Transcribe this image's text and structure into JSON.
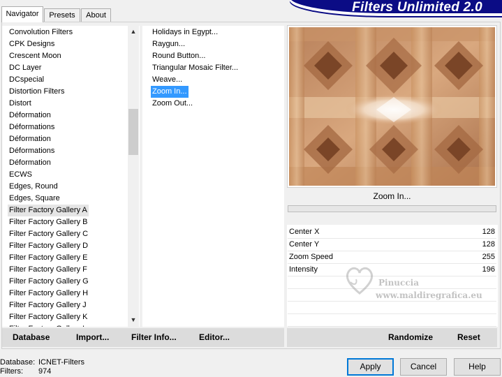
{
  "tabs": [
    {
      "label": "Navigator",
      "active": true
    },
    {
      "label": "Presets",
      "active": false
    },
    {
      "label": "About",
      "active": false
    }
  ],
  "banner": {
    "title": "Filters Unlimited 2.0"
  },
  "categories": {
    "items": [
      "Convolution Filters",
      "CPK Designs",
      "Crescent Moon",
      "DC Layer",
      "DCspecial",
      "Distortion Filters",
      "Distort",
      "Déformation",
      "Déformations",
      "Déformation",
      "Déformations",
      "Déformation",
      "ECWS",
      "Edges, Round",
      "Edges, Square",
      "Filter Factory Gallery A",
      "Filter Factory Gallery B",
      "Filter Factory Gallery C",
      "Filter Factory Gallery D",
      "Filter Factory Gallery E",
      "Filter Factory Gallery F",
      "Filter Factory Gallery G",
      "Filter Factory Gallery H",
      "Filter Factory Gallery J",
      "Filter Factory Gallery K",
      "Filter Factory Gallery L"
    ],
    "selected_index": 15
  },
  "filters": {
    "items": [
      "Holidays in Egypt...",
      "Raygun...",
      "Round Button...",
      "Triangular Mosaic Filter...",
      "Weave...",
      "Zoom In...",
      "Zoom Out..."
    ],
    "selected_index": 5
  },
  "preview": {
    "filter_name": "Zoom In..."
  },
  "params": [
    {
      "label": "Center X",
      "value": "128"
    },
    {
      "label": "Center Y",
      "value": "128"
    },
    {
      "label": "Zoom Speed",
      "value": "255"
    },
    {
      "label": "Intensity",
      "value": "196"
    }
  ],
  "left_buttons": {
    "database": "Database",
    "import": "Import...",
    "filter_info": "Filter Info...",
    "editor": "Editor..."
  },
  "right_buttons": {
    "randomize": "Randomize",
    "reset": "Reset"
  },
  "status": {
    "database_label": "Database:",
    "database_value": "ICNET-Filters",
    "filters_label": "Filters:",
    "filters_value": "974"
  },
  "dialog_buttons": {
    "apply": "Apply",
    "cancel": "Cancel",
    "help": "Help"
  },
  "watermark": {
    "line1": "Pinuccia",
    "line2": "www.maldiregrafica.eu"
  }
}
